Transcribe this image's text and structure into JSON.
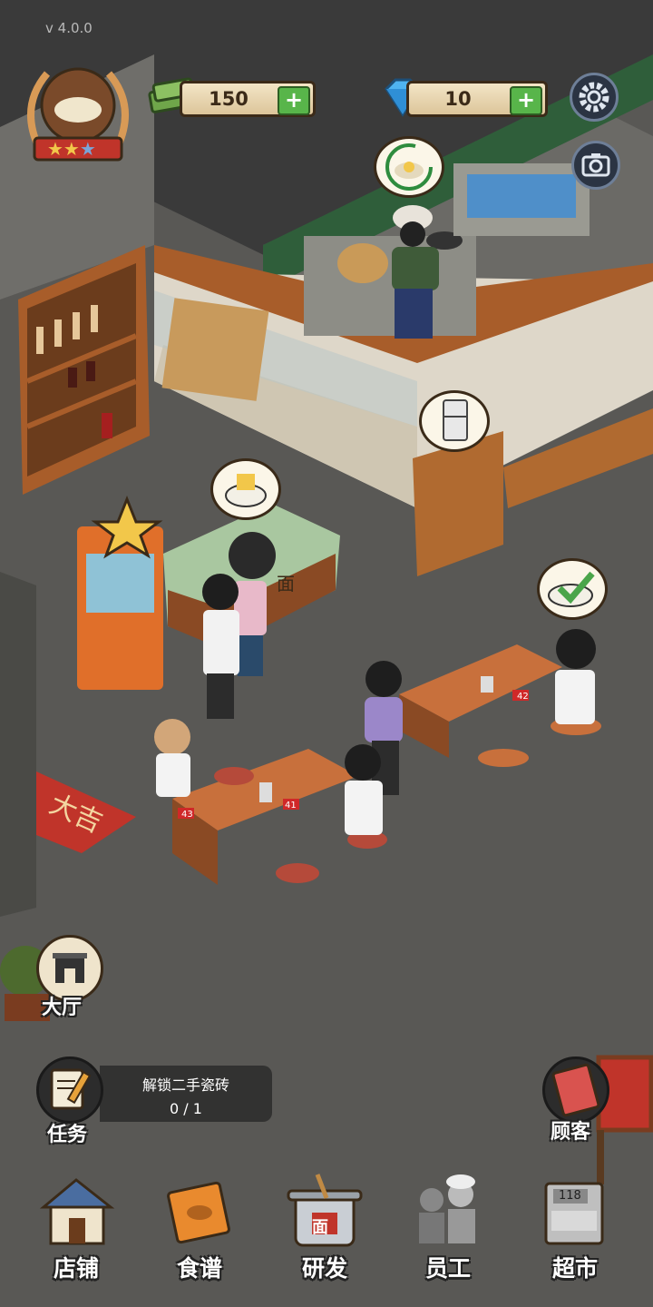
{
  "app": {
    "version": "v 4.0.0"
  },
  "restaurant_badge": {
    "stars": 3,
    "icon": "noodle-bowl-icon"
  },
  "currency": {
    "cash": {
      "icon": "cash-stack-icon",
      "value": "150",
      "add_label": "+"
    },
    "gems": {
      "icon": "diamond-icon",
      "value": "10",
      "add_label": "+"
    }
  },
  "top_buttons": {
    "settings_icon": "gear-icon",
    "camera_icon": "camera-icon"
  },
  "side": {
    "hall": {
      "icon": "building-icon",
      "label": "大厅"
    },
    "task": {
      "icon": "clipboard-pencil-icon",
      "label": "任务",
      "title": "解锁二手瓷砖",
      "progress": "0 / 1"
    },
    "customers": {
      "icon": "guest-book-icon",
      "label": "顾客"
    }
  },
  "bottom_nav": [
    {
      "label": "店铺",
      "icon": "shop-icon"
    },
    {
      "label": "食谱",
      "icon": "recipe-book-icon"
    },
    {
      "label": "研发",
      "icon": "noodle-pot-icon",
      "pot_label": "面"
    },
    {
      "label": "员工",
      "icon": "staff-icon"
    },
    {
      "label": "超市",
      "icon": "supermarket-register-icon",
      "register_number": "118"
    }
  ],
  "scene": {
    "table_numbers": [
      "41",
      "42",
      "43"
    ],
    "counter_sign": "面",
    "mat_text": "大吉",
    "bubbles": [
      "noodle-bowl-request-icon",
      "soup-bowl-cooking-icon",
      "fridge-icon",
      "dish-served-check-icon"
    ]
  },
  "colors": {
    "floor": "#595855",
    "wall_green": "#2f5e3a",
    "nav_plus": "#58b54a",
    "wood": "#a85d2a"
  }
}
